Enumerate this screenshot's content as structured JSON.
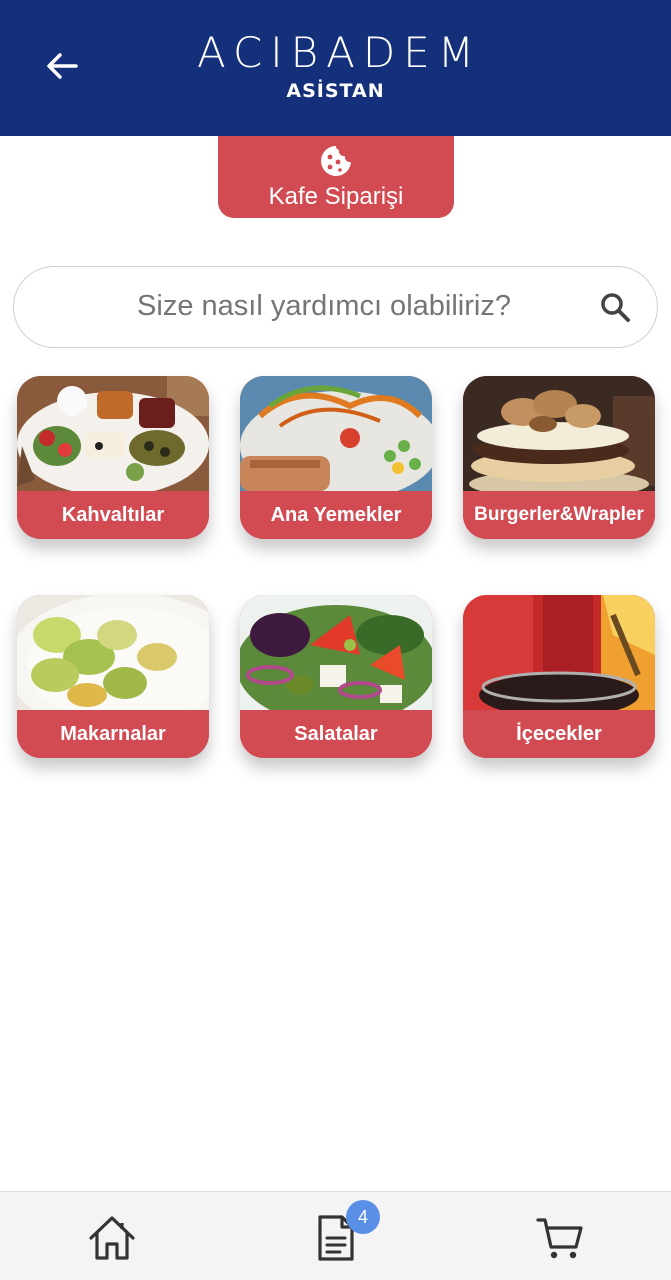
{
  "header": {
    "brand_name": "ACIBADEM",
    "brand_sub": "ASİSTAN",
    "back_icon": "arrow-left-icon",
    "background": "#15307a"
  },
  "cafe_tab": {
    "label": "Kafe Siparişi",
    "icon": "cookie-icon",
    "color": "#d24b53"
  },
  "search": {
    "placeholder": "Size nasıl yardımcı olabiliriz?",
    "value": "",
    "icon": "search-icon"
  },
  "categories": [
    {
      "label": "Kahvaltılar"
    },
    {
      "label": "Ana Yemekler"
    },
    {
      "label": "Burgerler&Wrapler"
    },
    {
      "label": "Makarnalar"
    },
    {
      "label": "Salatalar"
    },
    {
      "label": "İçecekler"
    }
  ],
  "bottom_nav": {
    "items": [
      {
        "icon": "home-icon"
      },
      {
        "icon": "document-icon",
        "badge": "4"
      },
      {
        "icon": "cart-icon"
      }
    ],
    "badge_color": "#5a8fe8"
  }
}
